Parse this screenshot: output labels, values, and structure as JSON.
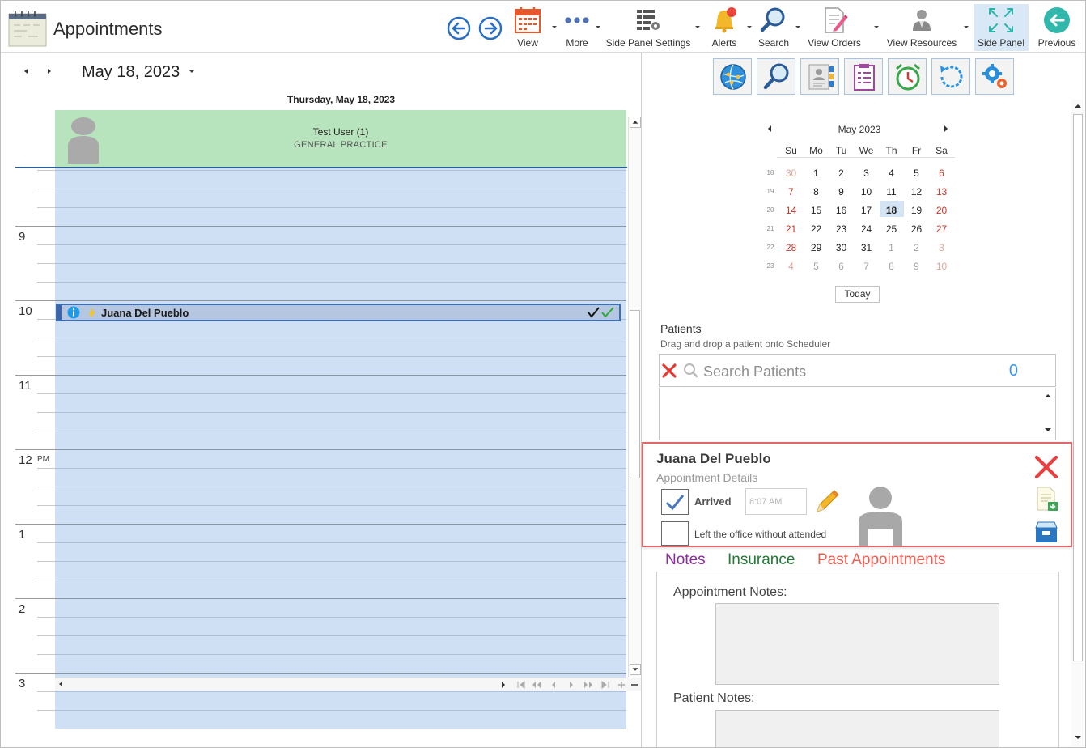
{
  "window": {
    "title": "Appointments"
  },
  "toolbar": {
    "items": [
      {
        "label": "View",
        "icon": "calendar-icon",
        "has_dropdown": true
      },
      {
        "label": "More",
        "icon": "more-dots-icon",
        "has_dropdown": true
      },
      {
        "label": "Side Panel Settings",
        "icon": "grid-settings-icon",
        "has_dropdown": true
      },
      {
        "label": "Alerts",
        "icon": "bell-alert-icon",
        "has_dropdown": true
      },
      {
        "label": "Search",
        "icon": "magnifier-icon",
        "has_dropdown": true
      },
      {
        "label": "View Orders",
        "icon": "edit-document-icon",
        "has_dropdown": true
      },
      {
        "label": "View Resources",
        "icon": "users-icon",
        "has_dropdown": true
      },
      {
        "label": "Side Panel",
        "icon": "expand-arrows-icon",
        "active": true
      },
      {
        "label": "Previous",
        "icon": "back-circle-icon"
      }
    ]
  },
  "scheduler": {
    "current_date": "May 18, 2023",
    "day_header": "Thursday, May 18, 2023",
    "resource": {
      "name": "Test User (1)",
      "specialty": "GENERAL PRACTICE"
    },
    "hours": [
      {
        "label": "9"
      },
      {
        "label": "10"
      },
      {
        "label": "11"
      },
      {
        "label": "12",
        "ampm": "PM"
      },
      {
        "label": "1"
      },
      {
        "label": "2"
      },
      {
        "label": "3"
      }
    ],
    "appointment": {
      "title": "Juana Del Pueblo",
      "status": "arrived"
    }
  },
  "side_panel": {
    "icon_buttons": [
      "globe-network-icon",
      "search-icon",
      "contact-card-icon",
      "checklist-icon",
      "alarm-clock-icon",
      "refresh-icon",
      "settings-gears-icon"
    ],
    "mini_calendar": {
      "title": "May 2023",
      "days_of_week": [
        "Su",
        "Mo",
        "Tu",
        "We",
        "Th",
        "Fr",
        "Sa"
      ],
      "weeks": [
        {
          "number": "18",
          "days": [
            "30",
            "1",
            "2",
            "3",
            "4",
            "5",
            "6"
          ]
        },
        {
          "number": "19",
          "days": [
            "7",
            "8",
            "9",
            "10",
            "11",
            "12",
            "13"
          ]
        },
        {
          "number": "20",
          "days": [
            "14",
            "15",
            "16",
            "17",
            "18",
            "19",
            "20"
          ]
        },
        {
          "number": "21",
          "days": [
            "21",
            "22",
            "23",
            "24",
            "25",
            "26",
            "27"
          ]
        },
        {
          "number": "22",
          "days": [
            "28",
            "29",
            "30",
            "31",
            "1",
            "2",
            "3"
          ]
        },
        {
          "number": "23",
          "days": [
            "4",
            "5",
            "6",
            "7",
            "8",
            "9",
            "10"
          ]
        }
      ],
      "selected_day": "18",
      "today_label": "Today"
    },
    "patients": {
      "title": "Patients",
      "hint": "Drag and drop a patient onto Scheduler",
      "search_placeholder": "Search Patients",
      "count": "0"
    },
    "appointment_details": {
      "patient_name": "Juana Del Pueblo",
      "subtitle": "Appointment Details",
      "arrived_label": "Arrived",
      "arrived_checked": true,
      "arrived_time": "8:07 AM",
      "left_office_label": "Left the office without attended",
      "left_office_checked": false
    },
    "tabs": [
      {
        "label": "Notes",
        "color": "#8a2a9c"
      },
      {
        "label": "Insurance",
        "color": "#1f7a34"
      },
      {
        "label": "Past Appointments",
        "color": "#ee5c50"
      }
    ],
    "notes": {
      "appointment_notes_label": "Appointment Notes:",
      "patient_notes_label": "Patient Notes:"
    }
  },
  "colors": {
    "resource_header": "#b7e3bd",
    "schedule_background": "#cfe0f5",
    "appointment_bar": "#b4c6e0",
    "weekend_day": "#c0392b",
    "highlight_border": "#e06868"
  }
}
